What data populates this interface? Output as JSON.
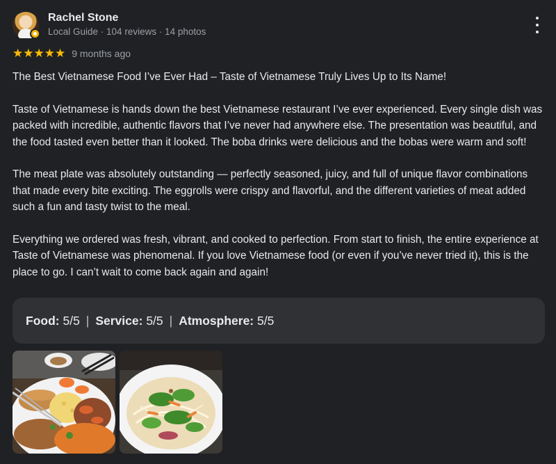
{
  "reviewer": {
    "name": "Rachel Stone",
    "meta": "Local Guide · 104 reviews · 14 photos",
    "avatar_icon": "profile-photo",
    "badge_icon": "local-guide-badge"
  },
  "menu_icon": "more-vert-icon",
  "rating": {
    "stars": "★★★★★",
    "value": 5,
    "max": 5,
    "time": "9 months ago",
    "star_color": "#fbbc04"
  },
  "review": {
    "title": "The Best Vietnamese Food I’ve Ever Had – Taste of Vietnamese Truly Lives Up to Its Name!",
    "paragraphs": [
      "Taste of Vietnamese is hands down the best Vietnamese restaurant I’ve ever experienced. Every single dish was packed with incredible, authentic flavors that I’ve never had anywhere else. The presentation was beautiful, and the food tasted even better than it looked. The boba drinks were delicious and the bobas were warm and soft!",
      "The meat plate was absolutely outstanding — perfectly seasoned, juicy, and full of unique flavor combinations that made every bite exciting. The eggrolls were crispy and flavorful, and the different varieties of meat added such a fun and tasty twist to the meal.",
      "Everything we ordered was fresh, vibrant, and cooked to perfection. From start to finish, the entire experience at Taste of Vietnamese was phenomenal. If you love Vietnamese food (or even if you’ve never tried it), this is the place to go. I can’t wait to come back again and again!"
    ]
  },
  "subratings": {
    "food_label": "Food:",
    "food_value": "5/5",
    "service_label": "Service:",
    "service_value": "5/5",
    "atmosphere_label": "Atmosphere:",
    "atmosphere_value": "5/5",
    "separator": "|"
  },
  "photos": [
    {
      "name": "photo-meat-plate"
    },
    {
      "name": "photo-noodle-salad"
    }
  ],
  "colors": {
    "background": "#202124",
    "panel": "#303134",
    "text": "#e8eaed",
    "muted": "#9aa0a6"
  }
}
